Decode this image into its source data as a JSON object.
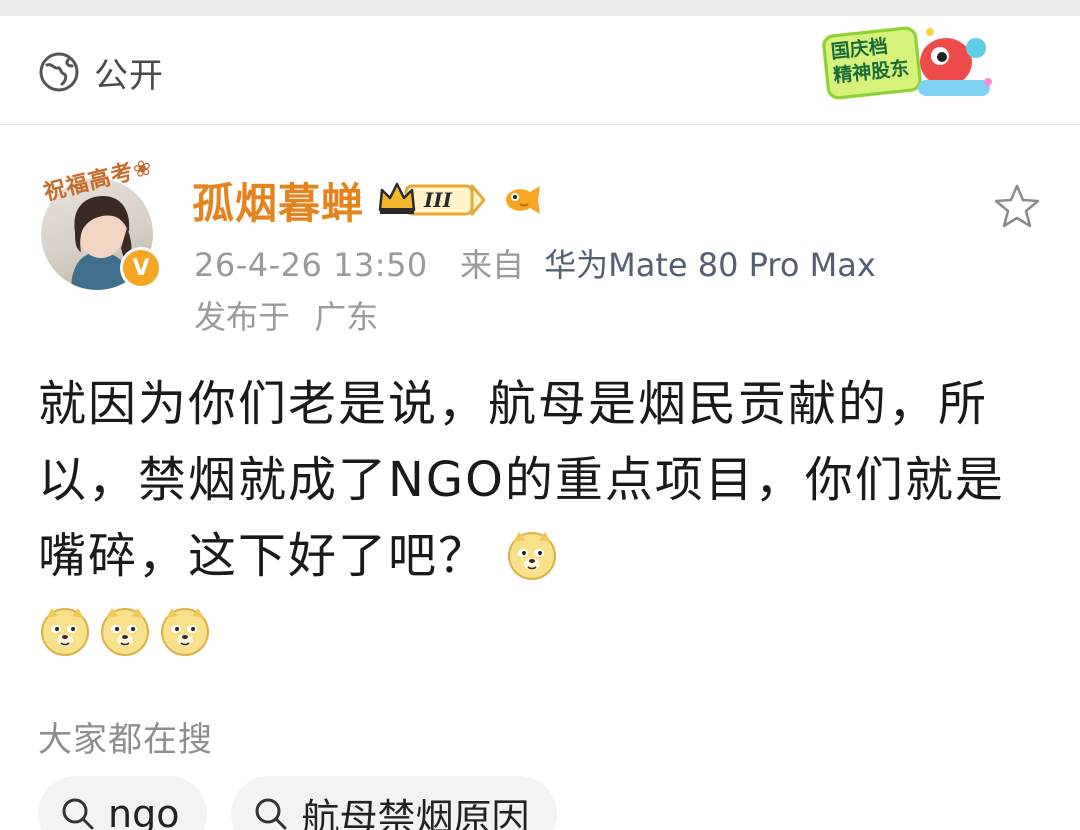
{
  "header": {
    "visibility_label": "公开",
    "promo_text_line1": "国庆档",
    "promo_text_line2": "精神股东"
  },
  "post": {
    "avatar_deco_text": "祝福高考❀",
    "username": "孤烟暮蝉",
    "badge_level": "III",
    "timestamp": "26-4-26 13:50",
    "source_prefix": "来自",
    "device": "华为Mate 80 Pro Max",
    "location_prefix": "发布于",
    "location": "广东",
    "content_text": "就因为你们老是说，航母是烟民贡献的，所以，禁烟就成了NGO的重点项目，你们就是嘴碎，这下好了吧？",
    "emoji_count": 4,
    "emoji_name": "doge-emoji"
  },
  "trending": {
    "title": "大家都在搜",
    "chips": [
      {
        "label": "ngo"
      },
      {
        "label": "航母禁烟原因"
      }
    ]
  },
  "colors": {
    "username": "#e5841f",
    "device_link": "#555f74",
    "meta_gray": "#9a9a9a",
    "verified_badge": "#f5a623"
  }
}
